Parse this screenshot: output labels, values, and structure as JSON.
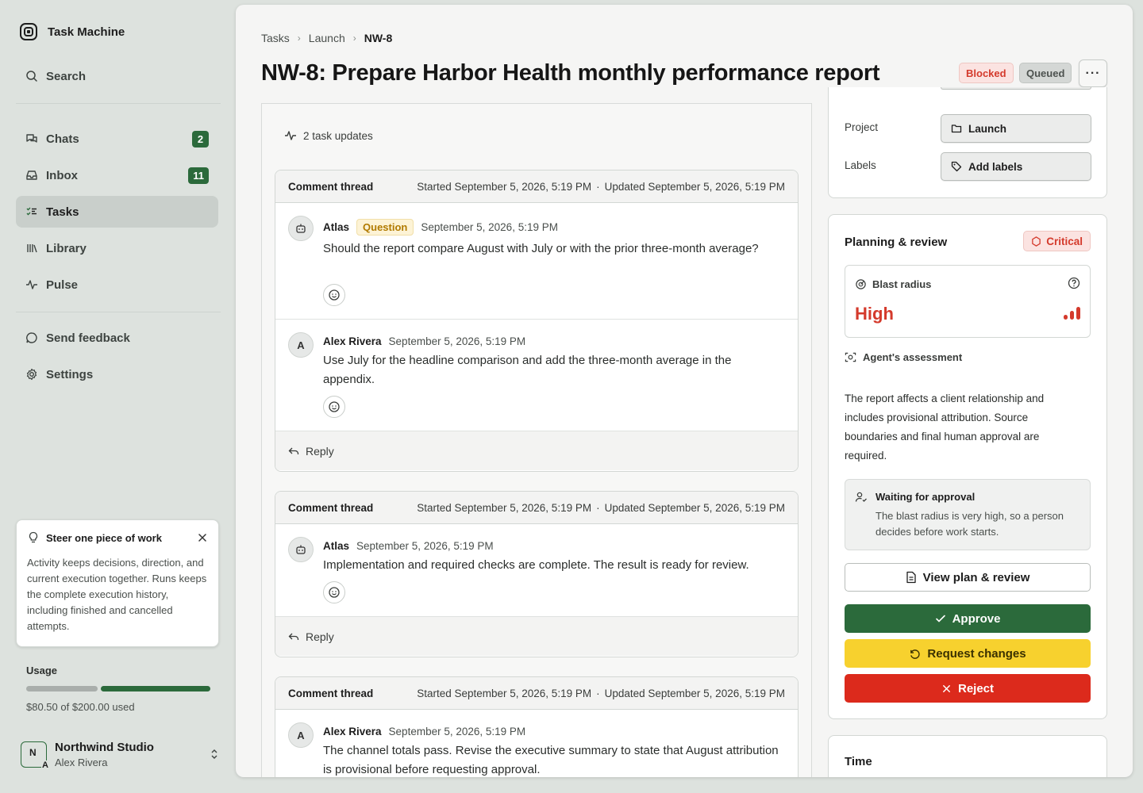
{
  "app": {
    "title": "Task Machine"
  },
  "sidebar": {
    "search_label": "Search",
    "items": [
      {
        "label": "Chats",
        "count": "2",
        "icon": "chats-icon"
      },
      {
        "label": "Inbox",
        "count": "11",
        "icon": "inbox-icon"
      },
      {
        "label": "Tasks",
        "count": null,
        "icon": "tasks-icon",
        "active": true
      },
      {
        "label": "Library",
        "count": null,
        "icon": "library-icon"
      },
      {
        "label": "Pulse",
        "count": null,
        "icon": "pulse-icon"
      }
    ],
    "feedback_label": "Send feedback",
    "settings_label": "Settings",
    "tip": {
      "title": "Steer one piece of work",
      "body": "Activity keeps decisions, direction, and current execution together. Runs keeps the complete execution history, including finished and cancelled attempts."
    },
    "usage": {
      "label": "Usage",
      "value_text": "$80.50 of $200.00 used",
      "used_fraction": 0.4025
    },
    "account": {
      "org": "Northwind Studio",
      "user": "Alex Rivera",
      "avatar_initials": "N",
      "avatar_sub": "A"
    }
  },
  "breadcrumb": {
    "items": [
      "Tasks",
      "Launch"
    ],
    "current": "NW-8"
  },
  "task": {
    "title": "NW-8: Prepare Harbor Health monthly performance report",
    "status_tags": [
      "Blocked",
      "Queued"
    ],
    "more_label": "···"
  },
  "activity": {
    "updates_label": "2 task updates",
    "reply_label": "Reply",
    "threads": [
      {
        "label": "Comment thread",
        "started": "Started September 5, 2026, 5:19 PM",
        "updated": "Updated September 5, 2026, 5:19 PM",
        "comments": [
          {
            "author": "Atlas",
            "tag": "Question",
            "time": "September 5, 2026, 5:19 PM",
            "body": "Should the report compare August with July or with the prior three-month average?"
          },
          {
            "author": "Alex Rivera",
            "avatar": "A",
            "time": "September 5, 2026, 5:19 PM",
            "body": "Use July for the headline comparison and add the three-month average in the appendix."
          }
        ]
      },
      {
        "label": "Comment thread",
        "started": "Started September 5, 2026, 5:19 PM",
        "updated": "Updated September 5, 2026, 5:19 PM",
        "comments": [
          {
            "author": "Atlas",
            "time": "September 5, 2026, 5:19 PM",
            "body": "Implementation and required checks are complete. The result is ready for review."
          }
        ]
      },
      {
        "label": "Comment thread",
        "started": "Started September 5, 2026, 5:19 PM",
        "updated": "Updated September 5, 2026, 5:19 PM",
        "comments": [
          {
            "author": "Alex Rivera",
            "avatar": "A",
            "time": "September 5, 2026, 5:19 PM",
            "body": "The channel totals pass. Revise the executive summary to state that August attribution is provisional before requesting approval."
          }
        ]
      }
    ]
  },
  "properties": {
    "project_label": "Project",
    "project_value": "Launch",
    "labels_label": "Labels",
    "labels_value": "Add labels"
  },
  "review": {
    "title": "Planning & review",
    "priority": "Critical",
    "blast_label": "Blast radius",
    "blast_value": "High",
    "blast_level": 3,
    "assessment_label": "Agent's assessment",
    "assessment_text": "The report affects a client relationship and includes provisional attribution. Source boundaries and final human approval are required.",
    "waiting_title": "Waiting for approval",
    "waiting_text": "The blast radius is very high, so a person decides before work starts.",
    "view_plan_label": "View plan & review",
    "approve_label": "Approve",
    "request_changes_label": "Request changes",
    "reject_label": "Reject"
  },
  "time": {
    "title": "Time"
  },
  "colors": {
    "accent": "#2b6a3b",
    "danger": "#dc2a1c",
    "warning": "#f7d12e",
    "question": "#b17a00"
  }
}
